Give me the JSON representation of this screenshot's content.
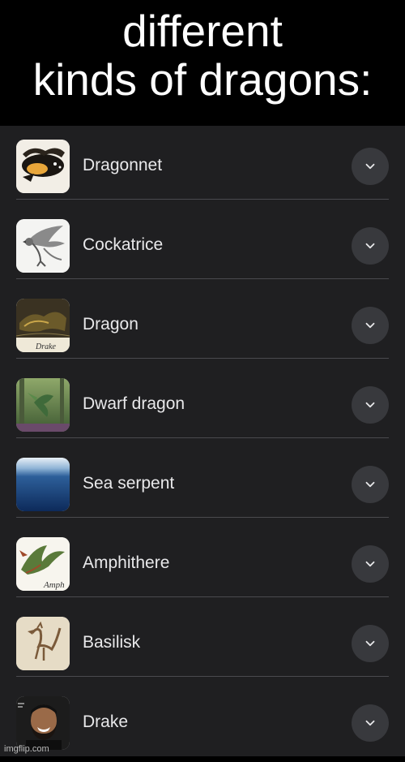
{
  "caption": {
    "line1": "different",
    "line2": "kinds of dragons:"
  },
  "items": [
    {
      "label": "Dragonnet",
      "icon": "dragonnet-thumbnail-icon"
    },
    {
      "label": "Cockatrice",
      "icon": "cockatrice-thumbnail-icon"
    },
    {
      "label": "Dragon",
      "icon": "drake-illustration-thumbnail-icon",
      "thumb_text": "Drake"
    },
    {
      "label": "Dwarf dragon",
      "icon": "dwarf-dragon-thumbnail-icon"
    },
    {
      "label": "Sea serpent",
      "icon": "sea-thumbnail-icon"
    },
    {
      "label": "Amphithere",
      "icon": "amphithere-thumbnail-icon",
      "thumb_text": "Amph"
    },
    {
      "label": "Basilisk",
      "icon": "basilisk-thumbnail-icon"
    },
    {
      "label": "Drake",
      "icon": "drake-photo-thumbnail-icon"
    }
  ],
  "expand_icon": "chevron-down-icon",
  "watermark": "imgflip.com",
  "colors": {
    "caption_bg": "#000000",
    "caption_text": "#ffffff",
    "list_bg": "#1f1f21",
    "label_text": "#e8e8ea",
    "chevron_bg": "#38393d",
    "divider": "#4a4a4e"
  }
}
